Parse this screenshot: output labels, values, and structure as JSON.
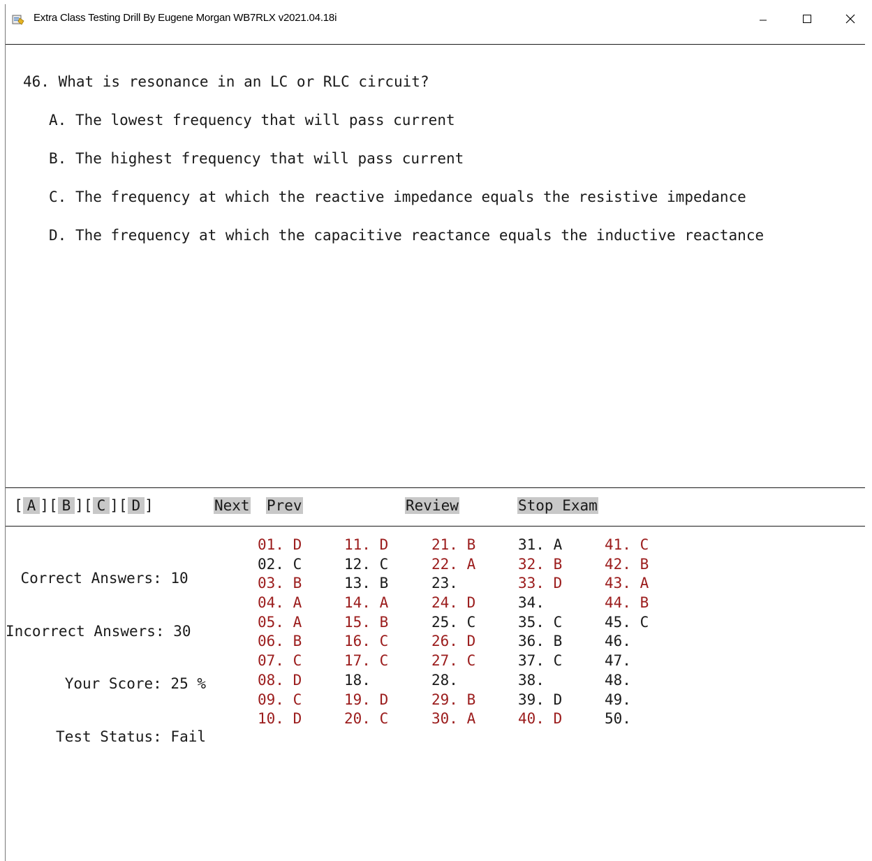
{
  "window": {
    "title": "Extra Class Testing Drill By Eugene Morgan WB7RLX v2021.04.18i",
    "controls": {
      "minimize": "—",
      "maximize": "☐",
      "close": "✕"
    }
  },
  "question": {
    "text": "46. What is resonance in an LC or RLC circuit?",
    "choices": [
      {
        "letter": "A.",
        "text": "The lowest frequency that will pass current"
      },
      {
        "letter": "B.",
        "text": "The highest frequency that will pass current"
      },
      {
        "letter": "C.",
        "text": "The frequency at which the reactive impedance equals the resistive impedance"
      },
      {
        "letter": "D.",
        "text": "The frequency at which the capacitive reactance equals the inductive reactance"
      }
    ]
  },
  "buttons": {
    "a": "A",
    "b": "B",
    "c": "C",
    "d": "D",
    "open": "[",
    "sep": "][",
    "close": "]",
    "next": "Next",
    "prev": "Prev",
    "review": "Review",
    "stop": "Stop Exam"
  },
  "stats": {
    "correct_label": "Correct Answers:",
    "correct_value": "10",
    "incorrect_label": "Incorrect Answers:",
    "incorrect_value": "30",
    "score_label": "Your Score:",
    "score_value": "25 %",
    "status_label": "Test Status:",
    "status_value": "Fail"
  },
  "answers": [
    [
      {
        "n": "01.",
        "a": "D",
        "s": "wrong"
      },
      {
        "n": "02.",
        "a": "C",
        "s": "right"
      },
      {
        "n": "03.",
        "a": "B",
        "s": "wrong"
      },
      {
        "n": "04.",
        "a": "A",
        "s": "wrong"
      },
      {
        "n": "05.",
        "a": "A",
        "s": "wrong"
      },
      {
        "n": "06.",
        "a": "B",
        "s": "wrong"
      },
      {
        "n": "07.",
        "a": "C",
        "s": "wrong"
      },
      {
        "n": "08.",
        "a": "D",
        "s": "wrong"
      },
      {
        "n": "09.",
        "a": "C",
        "s": "wrong"
      },
      {
        "n": "10.",
        "a": "D",
        "s": "wrong"
      }
    ],
    [
      {
        "n": "11.",
        "a": "D",
        "s": "wrong"
      },
      {
        "n": "12.",
        "a": "C",
        "s": "right"
      },
      {
        "n": "13.",
        "a": "B",
        "s": "right"
      },
      {
        "n": "14.",
        "a": "A",
        "s": "wrong"
      },
      {
        "n": "15.",
        "a": "B",
        "s": "wrong"
      },
      {
        "n": "16.",
        "a": "C",
        "s": "wrong"
      },
      {
        "n": "17.",
        "a": "C",
        "s": "wrong"
      },
      {
        "n": "18.",
        "a": "",
        "s": "blank"
      },
      {
        "n": "19.",
        "a": "D",
        "s": "wrong"
      },
      {
        "n": "20.",
        "a": "C",
        "s": "wrong"
      }
    ],
    [
      {
        "n": "21.",
        "a": "B",
        "s": "wrong"
      },
      {
        "n": "22.",
        "a": "A",
        "s": "wrong"
      },
      {
        "n": "23.",
        "a": "",
        "s": "blank"
      },
      {
        "n": "24.",
        "a": "D",
        "s": "wrong"
      },
      {
        "n": "25.",
        "a": "C",
        "s": "right"
      },
      {
        "n": "26.",
        "a": "D",
        "s": "wrong"
      },
      {
        "n": "27.",
        "a": "C",
        "s": "wrong"
      },
      {
        "n": "28.",
        "a": "",
        "s": "blank"
      },
      {
        "n": "29.",
        "a": "B",
        "s": "wrong"
      },
      {
        "n": "30.",
        "a": "A",
        "s": "wrong"
      }
    ],
    [
      {
        "n": "31.",
        "a": "A",
        "s": "right"
      },
      {
        "n": "32.",
        "a": "B",
        "s": "wrong"
      },
      {
        "n": "33.",
        "a": "D",
        "s": "wrong"
      },
      {
        "n": "34.",
        "a": "",
        "s": "blank"
      },
      {
        "n": "35.",
        "a": "C",
        "s": "right"
      },
      {
        "n": "36.",
        "a": "B",
        "s": "right"
      },
      {
        "n": "37.",
        "a": "C",
        "s": "right"
      },
      {
        "n": "38.",
        "a": "",
        "s": "blank"
      },
      {
        "n": "39.",
        "a": "D",
        "s": "right"
      },
      {
        "n": "40.",
        "a": "D",
        "s": "wrong"
      }
    ],
    [
      {
        "n": "41.",
        "a": "C",
        "s": "wrong"
      },
      {
        "n": "42.",
        "a": "B",
        "s": "wrong"
      },
      {
        "n": "43.",
        "a": "A",
        "s": "wrong"
      },
      {
        "n": "44.",
        "a": "B",
        "s": "wrong"
      },
      {
        "n": "45.",
        "a": "C",
        "s": "right"
      },
      {
        "n": "46.",
        "a": "",
        "s": "blank"
      },
      {
        "n": "47.",
        "a": "",
        "s": "blank"
      },
      {
        "n": "48.",
        "a": "",
        "s": "blank"
      },
      {
        "n": "49.",
        "a": "",
        "s": "blank"
      },
      {
        "n": "50.",
        "a": "",
        "s": "blank"
      }
    ]
  ],
  "colors": {
    "wrong": "#9b1c1c",
    "right": "#1a1a1a",
    "button_bg": "#c8c8c8"
  }
}
